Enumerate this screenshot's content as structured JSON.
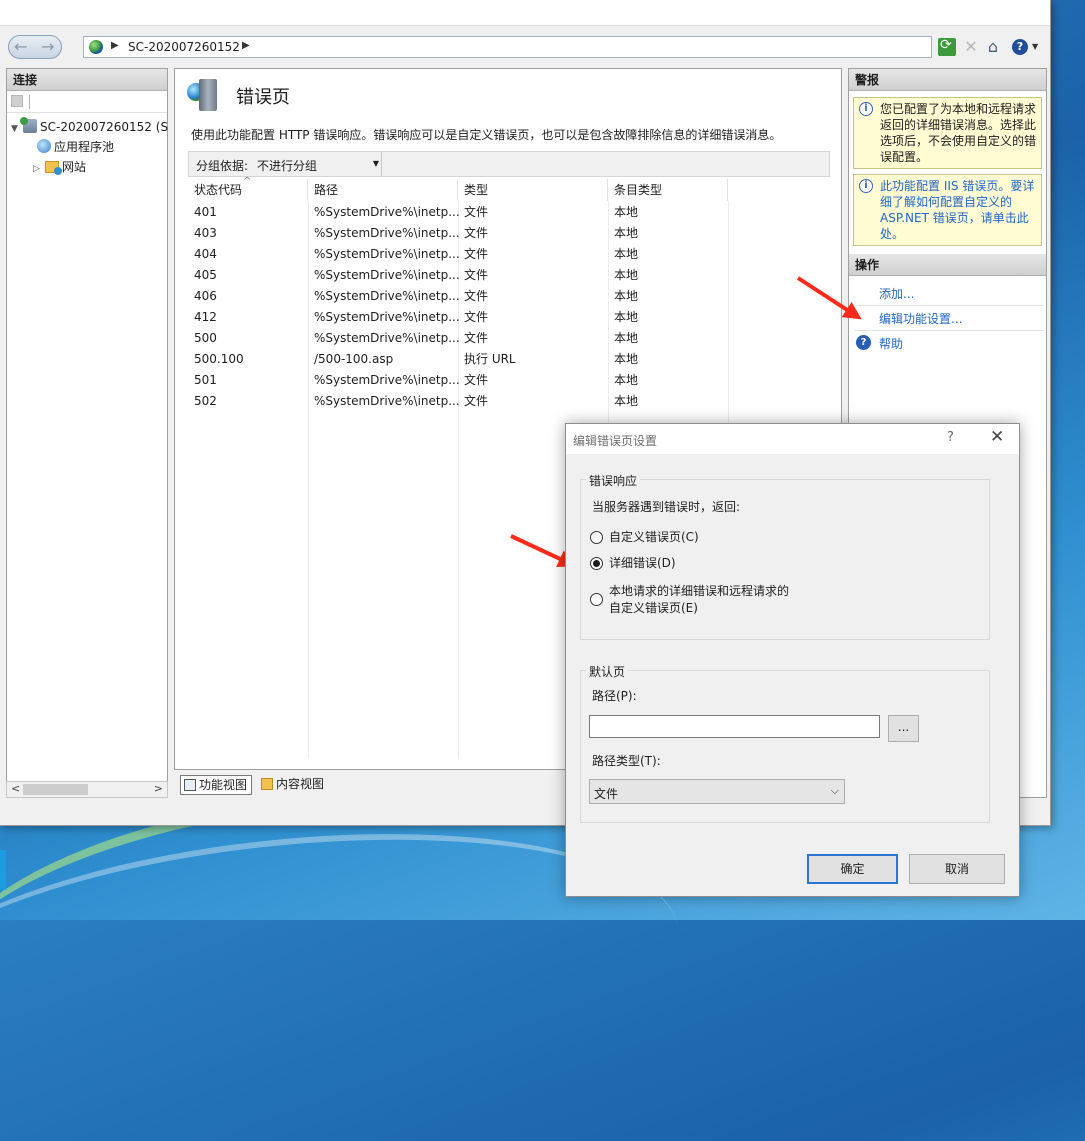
{
  "address": {
    "server": "SC-202007260152"
  },
  "left_panel": {
    "title": "连接",
    "tree": [
      {
        "label": "SC-202007260152 (S",
        "level": 0
      },
      {
        "label": "应用程序池",
        "level": 1
      },
      {
        "label": "网站",
        "level": 1
      }
    ]
  },
  "center": {
    "title": "错误页",
    "description": "使用此功能配置 HTTP 错误响应。错误响应可以是自定义错误页，也可以是包含故障排除信息的详细错误消息。",
    "group_label": "分组依据:",
    "group_value": "不进行分组",
    "columns": [
      "状态代码",
      "路径",
      "类型",
      "条目类型"
    ],
    "rows": [
      [
        "401",
        "%SystemDrive%\\inetp...",
        "文件",
        "本地"
      ],
      [
        "403",
        "%SystemDrive%\\inetp...",
        "文件",
        "本地"
      ],
      [
        "404",
        "%SystemDrive%\\inetp...",
        "文件",
        "本地"
      ],
      [
        "405",
        "%SystemDrive%\\inetp...",
        "文件",
        "本地"
      ],
      [
        "406",
        "%SystemDrive%\\inetp...",
        "文件",
        "本地"
      ],
      [
        "412",
        "%SystemDrive%\\inetp...",
        "文件",
        "本地"
      ],
      [
        "500",
        "%SystemDrive%\\inetp...",
        "文件",
        "本地"
      ],
      [
        "500.100",
        "/500-100.asp",
        "执行 URL",
        "本地"
      ],
      [
        "501",
        "%SystemDrive%\\inetp...",
        "文件",
        "本地"
      ],
      [
        "502",
        "%SystemDrive%\\inetp...",
        "文件",
        "本地"
      ]
    ],
    "tabs": {
      "feature_view": "功能视图",
      "content_view": "内容视图"
    }
  },
  "right_panel": {
    "alerts_title": "警报",
    "alert1": "您已配置了为本地和远程请求返回的详细错误消息。选择此选项后，不会使用自定义的错误配置。",
    "alert2": "此功能配置 IIS 错误页。要详细了解如何配置自定义的 ASP.NET 错误页，请单击此处。",
    "actions_title": "操作",
    "actions": {
      "add": "添加...",
      "edit": "编辑功能设置...",
      "help": "帮助"
    }
  },
  "dialog": {
    "title": "编辑错误页设置",
    "help_glyph": "?",
    "close_glyph": "✕",
    "error_response_legend": "错误响应",
    "prompt": "当服务器遇到错误时，返回:",
    "options": {
      "custom": "自定义错误页(C)",
      "detailed": "详细错误(D)",
      "mixed_line1": "本地请求的详细错误和远程请求的",
      "mixed_line2": "自定义错误页(E)"
    },
    "selected_option": "detailed",
    "default_page_legend": "默认页",
    "path_label": "路径(P):",
    "path_value": "",
    "browse_label": "...",
    "path_type_label": "路径类型(T):",
    "path_type_value": "文件",
    "ok": "确定",
    "cancel": "取消"
  }
}
